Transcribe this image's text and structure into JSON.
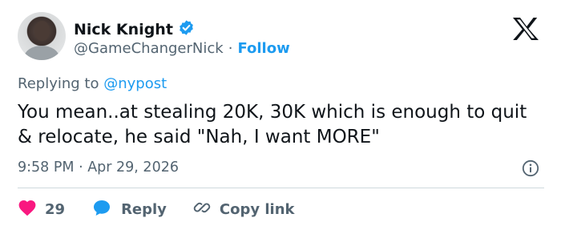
{
  "author": {
    "name": "Nick Knight",
    "handle": "@GameChangerNick",
    "separator": "·",
    "follow_label": "Follow",
    "verified": true
  },
  "reply_context": {
    "prefix": "Replying to ",
    "mention": "@nypost"
  },
  "tweet": {
    "text": "You mean..at stealing 20K, 30K which is enough to quit & relocate, he said \"Nah, I want MORE\"",
    "timestamp": "9:58 PM · Apr 29, 2026"
  },
  "actions": {
    "like_count": "29",
    "reply_label": "Reply",
    "copy_link_label": "Copy link"
  },
  "icons": {
    "verified": "verified-badge-icon",
    "logo": "x-logo-icon",
    "info": "info-icon",
    "like": "heart-icon",
    "reply": "speech-bubble-icon",
    "copy": "link-icon"
  },
  "colors": {
    "accent": "#1d9bf0",
    "like": "#f91880",
    "text": "#0f1419",
    "muted": "#536471",
    "divider": "#cfd9de"
  }
}
